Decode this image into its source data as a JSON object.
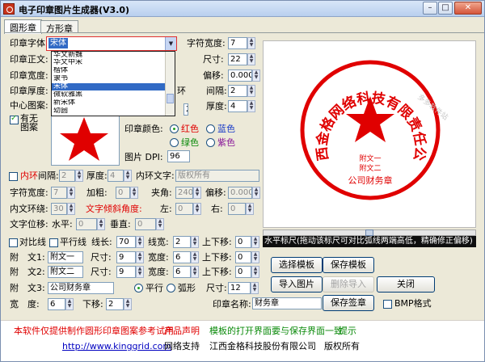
{
  "window": {
    "title": "电子印章图片生成器(V3.0)",
    "controls": {
      "minimize": "–",
      "maximize": "□",
      "close": "✕"
    }
  },
  "tabs": [
    "圆形章",
    "方形章"
  ],
  "font_section": {
    "label": "印章字体:",
    "value": "宋体",
    "options": [
      "华文新魏",
      "华文中宋",
      "楷体",
      "隶书",
      "宋体",
      "微软雅黑",
      "新宋体",
      "幼圆"
    ],
    "selected_index": 4
  },
  "left_labels": {
    "body_text": "印章正文:",
    "width": "印章宽度:",
    "thickness": "印章厚度:",
    "center_pattern": "中心图案:",
    "has_pattern": "有无图案",
    "ring_partial": "环"
  },
  "right_top": {
    "char_width": {
      "label": "字符宽度:",
      "value": "7"
    },
    "size": {
      "label": "尺寸:",
      "value": "22"
    },
    "offset": {
      "label": "偏移:",
      "value": "0.000"
    },
    "spacing": {
      "label": "间隔:",
      "value": "2"
    },
    "thickness2": {
      "label": "厚度:",
      "value": "4"
    }
  },
  "pattern": {
    "width_value": "2",
    "color_label": "印章颜色:",
    "colors": [
      {
        "name": "红色",
        "hex": "#e00000",
        "checked": true
      },
      {
        "name": "蓝色",
        "hex": "#1a3cc8",
        "checked": false
      },
      {
        "name": "绿色",
        "hex": "#0a8a0a",
        "checked": false
      },
      {
        "name": "紫色",
        "hex": "#8a1a9a",
        "checked": false
      }
    ],
    "dpi_label": "图片 DPI:",
    "dpi_value": "96"
  },
  "inner_ring": {
    "label": "内环",
    "spacing_label": "间隔:",
    "spacing_value": "2",
    "thickness_label": "厚度:",
    "thickness_value": "4",
    "text_label": "内环文字:",
    "text_value": "版权所有",
    "char_width_label": "字符宽度:",
    "char_width_value": "7",
    "bold_label": "加粗:",
    "bold_value": "0",
    "angle_label": "夹角:",
    "angle_value": "240",
    "offset_label": "偏移:",
    "offset_value": "0.000",
    "ring_gap_label": "内文环绕:",
    "ring_gap_value": "30",
    "tilt_label": "文字倾斜角度:",
    "left_label": "左:",
    "left_value": "0",
    "right_label": "右:",
    "right_value": "0",
    "shift_label": "文字位移:",
    "h_label": "水平:",
    "h_value": "0",
    "v_label": "垂直:",
    "v_value": "0"
  },
  "ruler_row": {
    "compare_label": "对比线",
    "parallel_label": "平行线",
    "line_length_label": "线长:",
    "line_length_value": "70",
    "line_width_label": "线宽:",
    "line_width_value": "2",
    "up_down_label": "上下移:",
    "up_down_value": "0"
  },
  "sub_texts": [
    {
      "label": "附　文1:",
      "value": "附文一",
      "size_label": "尺寸:",
      "size": "9",
      "width_label": "宽度:",
      "width": "6",
      "move_label": "上下移:",
      "move": "0"
    },
    {
      "label": "附　文2:",
      "value": "附文二",
      "size_label": "尺寸:",
      "size": "9",
      "width_label": "宽度:",
      "width": "6",
      "move_label": "上下移:",
      "move": "0"
    }
  ],
  "sub_text3": {
    "label": "附　文3:",
    "value": "公司财务章",
    "parallel_label": "平行",
    "arc_label": "弧形",
    "size_label": "尺寸:",
    "size_value": "12"
  },
  "width_row": {
    "width_label": "宽　度:",
    "width_value": "6",
    "down_label": "下移:",
    "down_value": "2",
    "seal_name_label": "印章名称:",
    "seal_name_value": "财务章",
    "bmp_label": "BMP格式"
  },
  "buttons": {
    "select_template": "选择模板",
    "save_template": "保存模板",
    "import_image": "导入图片",
    "delete_import": "删除导入",
    "close": "关闭",
    "save_seal": "保存签章"
  },
  "preview": {
    "company": "江西金格网络科技有限责任公司",
    "sub1": "附文一",
    "sub2": "附文二",
    "sub3": "公司财务章",
    "watermark": "多多软件站"
  },
  "hint": "水平标尺(拖动该标尺可对比弧线两端高低，精确修正偏移)",
  "footer": {
    "line1_a": "本软件仅提供制作圆形印章图案参考试用",
    "line1_b": "产品声明",
    "line1_c": "模板的打开界面要与保存界面一致",
    "line1_d": "提示",
    "url": "http://www.kinggrid.com",
    "support": "网络支持",
    "company": "江西金格科技股份有限公司",
    "rights": "版权所有"
  },
  "colors": {
    "accent": "#316ac5",
    "seal_red": "#e00000",
    "titlebar": "#c7d8f1"
  }
}
